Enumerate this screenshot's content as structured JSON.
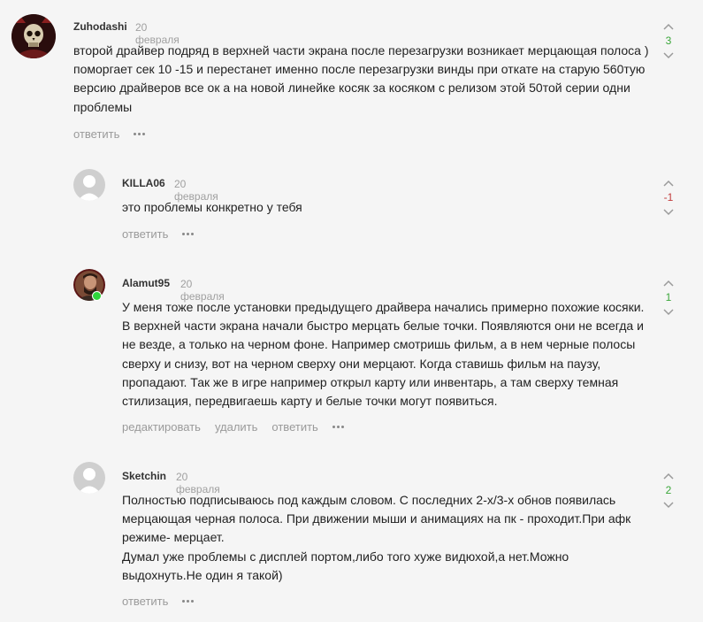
{
  "colors": {
    "positive": "#3aa639",
    "negative": "#c23b3b",
    "muted": "#9a9a9a"
  },
  "comments": [
    {
      "author": "Zuhodashi",
      "date": "20 февраля",
      "avatar": "skull-avatar",
      "text": "второй драйвер подряд в верхней части экрана после перезагрузки возникает мерцающая полоса ) поморгает сек 10 -15 и перестанет именно после перезагрузки винды при откате на старую 560тую версию драйверов все ок а на новой линейке косяк за косяком с релизом этой 50той серии одни проблемы",
      "score": "3",
      "actions": {
        "reply": "ответить"
      }
    },
    {
      "author": "KILLA06",
      "date": "20 февраля",
      "avatar": "default-avatar",
      "text": "это проблемы конкретно у тебя",
      "score": "-1",
      "actions": {
        "reply": "ответить"
      }
    },
    {
      "author": "Alamut95",
      "date": "20 февраля",
      "avatar": "photo-avatar",
      "online": true,
      "text": "У меня тоже после установки предыдущего драйвера начались примерно похожие косяки. В верхней части экрана начали быстро мерцать белые точки. Появляются они не всегда и не везде, а только на черном фоне. Например смотришь фильм, а в нем черные полосы сверху и снизу, вот на черном сверху они мерцают. Когда ставишь фильм на паузу, пропадают. Так же в игре например открыл карту или инвентарь, а там сверху темная стилизация, передвигаешь карту и белые точки могут появиться.",
      "score": "1",
      "actions": {
        "edit": "редактировать",
        "delete": "удалить",
        "reply": "ответить"
      }
    },
    {
      "author": "Sketchin",
      "date": "20 февраля",
      "avatar": "default-avatar",
      "text_lines": [
        "Полностью подписываюсь под каждым словом. С последних 2-х/3-х обнов появилась мерцающая черная полоса. При движении мыши и анимациях на пк - проходит.При афк режиме- мерцает.",
        "Думал уже проблемы с дисплей портом,либо того хуже видюхой,а нет.Можно выдохнуть.Не один я такой)"
      ],
      "score": "2",
      "actions": {
        "reply": "ответить"
      }
    }
  ]
}
